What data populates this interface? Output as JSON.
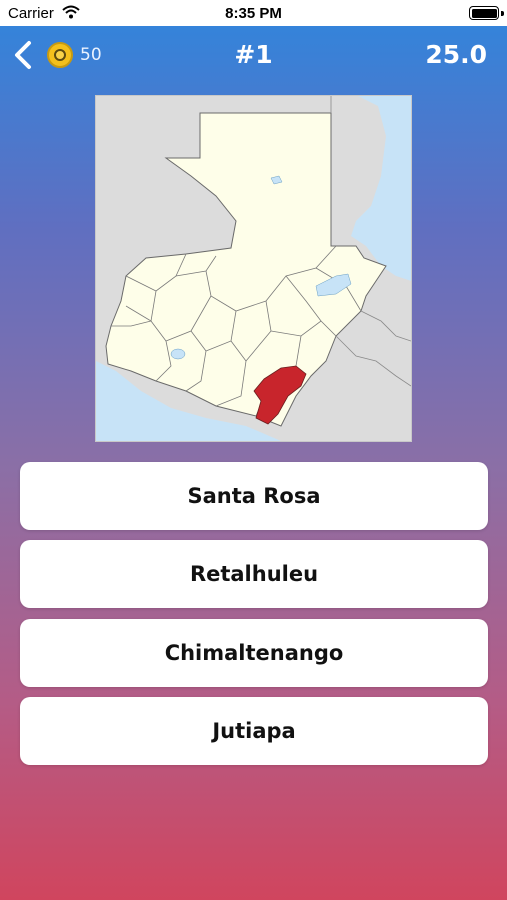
{
  "status_bar": {
    "carrier": "Carrier",
    "time": "8:35 PM"
  },
  "nav": {
    "back_icon": "chevron-left-icon",
    "coin_icon": "coin-icon",
    "coins": "50",
    "question_number": "#1",
    "timer": "25.0"
  },
  "map": {
    "highlight_color": "#c8252c",
    "land_color": "#fefee9",
    "water_color": "#c7e3f7",
    "neighbor_color": "#dcdcdc"
  },
  "answers": [
    {
      "label": "Santa Rosa"
    },
    {
      "label": "Retalhuleu"
    },
    {
      "label": "Chimaltenango"
    },
    {
      "label": "Jutiapa"
    }
  ]
}
